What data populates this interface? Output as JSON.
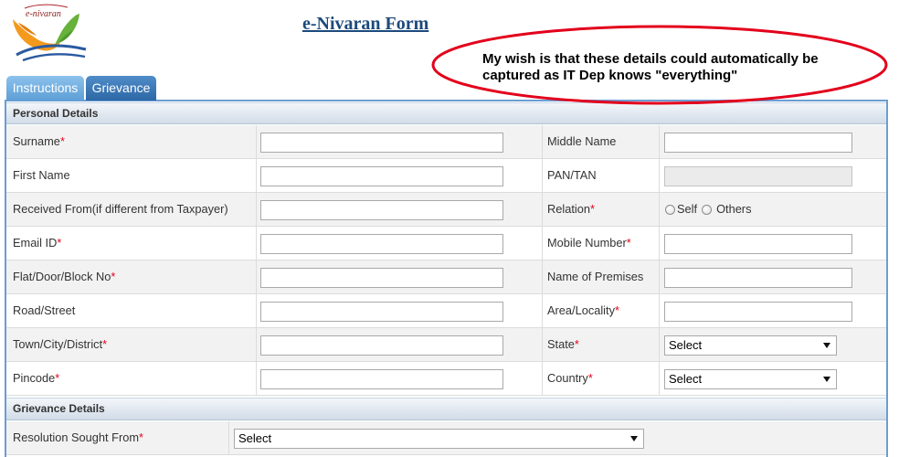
{
  "colors": {
    "title": "#1d4a7c",
    "tab_inactive": "#5e9fd6",
    "tab_active": "#2d68a6",
    "form_border": "#6c9dd2",
    "required": "#e2001a",
    "annotation_ring": "#e3001b"
  },
  "header": {
    "logo_text": "e-nivaran",
    "title": "e-Nivaran Form"
  },
  "annotation": {
    "line1": "My wish is that these details could automatically be",
    "line2": "captured as IT Dep knows \"everything\""
  },
  "tabs": [
    {
      "label": "Instructions",
      "active": false
    },
    {
      "label": "Grievance",
      "active": true
    }
  ],
  "required_mark": "*",
  "personal_details": {
    "title": "Personal Details",
    "rows": [
      {
        "left": {
          "label": "Surname",
          "required": true,
          "value": ""
        },
        "right": {
          "label": "Middle Name",
          "required": false,
          "value": ""
        }
      },
      {
        "left": {
          "label": "First Name",
          "required": false,
          "value": ""
        },
        "right": {
          "label": "PAN/TAN",
          "required": false,
          "value": "",
          "disabled": true
        }
      },
      {
        "left": {
          "label": "Received From(if different from Taxpayer)",
          "required": false,
          "value": ""
        },
        "right": {
          "label": "Relation",
          "required": true,
          "options": [
            "Self",
            "Others"
          ]
        }
      },
      {
        "left": {
          "label": "Email ID",
          "required": true,
          "value": ""
        },
        "right": {
          "label": "Mobile Number",
          "required": true,
          "value": ""
        }
      },
      {
        "left": {
          "label": "Flat/Door/Block No",
          "required": true,
          "value": ""
        },
        "right": {
          "label": "Name of Premises",
          "required": false,
          "value": ""
        }
      },
      {
        "left": {
          "label": "Road/Street",
          "required": false,
          "value": ""
        },
        "right": {
          "label": "Area/Locality",
          "required": true,
          "value": ""
        }
      },
      {
        "left": {
          "label": "Town/City/District",
          "required": true,
          "value": ""
        },
        "right": {
          "label": "State",
          "required": true,
          "selected": "Select"
        }
      },
      {
        "left": {
          "label": "Pincode",
          "required": true,
          "value": ""
        },
        "right": {
          "label": "Country",
          "required": true,
          "selected": "Select"
        }
      }
    ]
  },
  "grievance_details": {
    "title": "Grievance Details",
    "rows": [
      {
        "label": "Resolution Sought From",
        "required": true,
        "selected": "Select"
      }
    ]
  }
}
